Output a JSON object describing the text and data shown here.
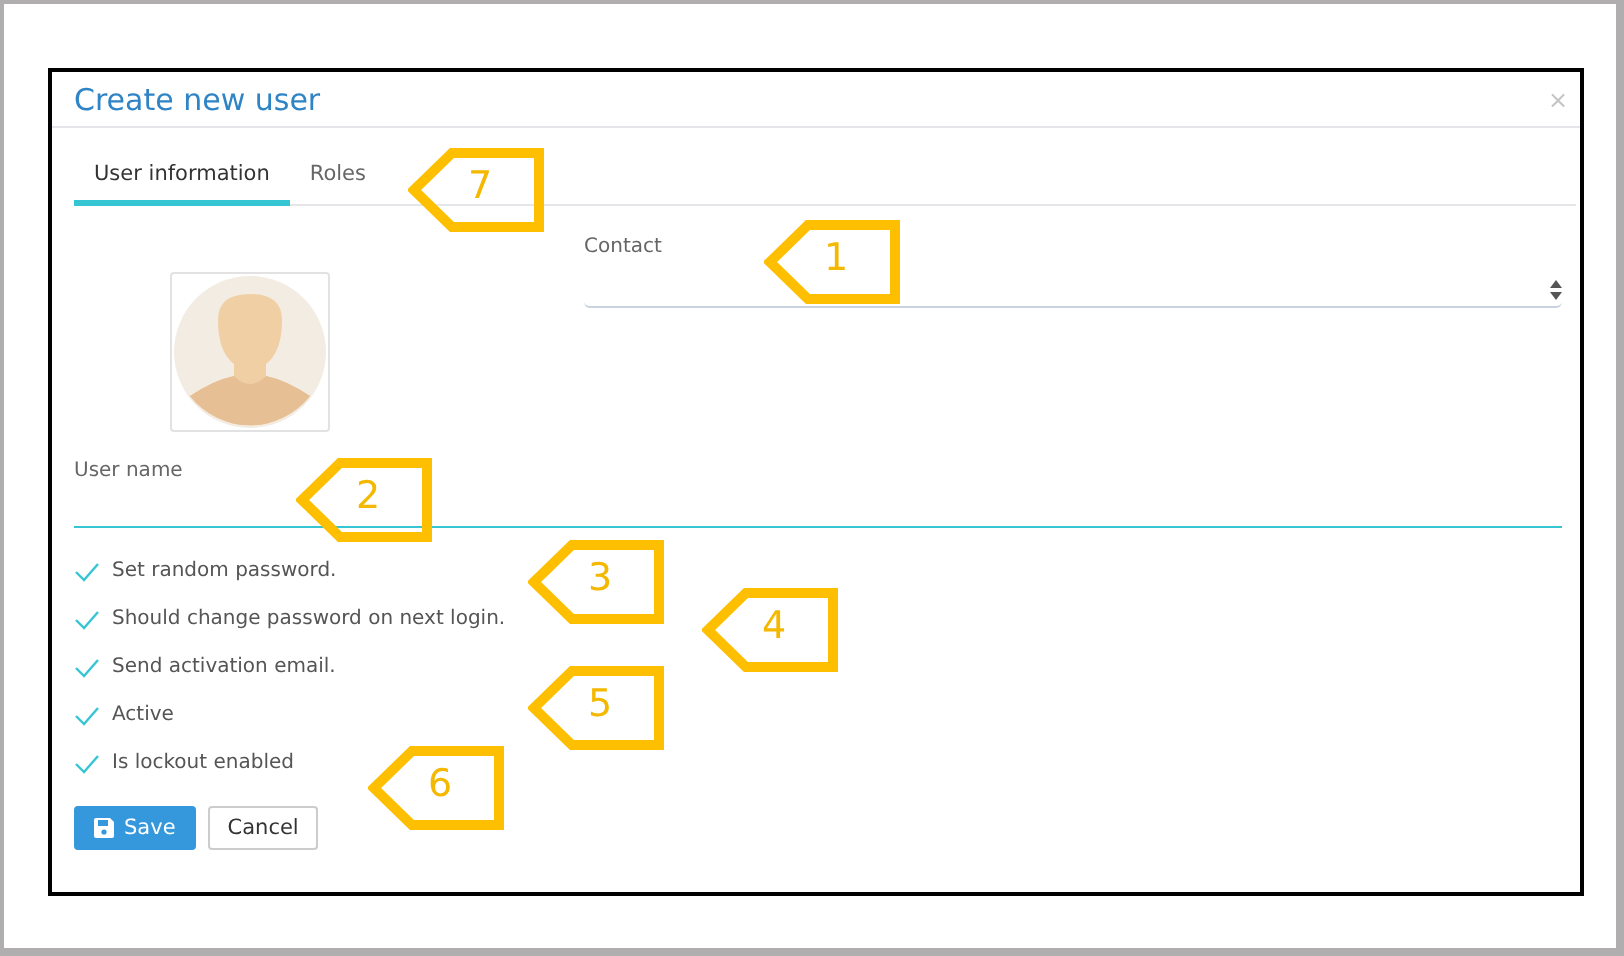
{
  "dialog": {
    "title": "Create new user",
    "close": "×"
  },
  "tabs": [
    {
      "label": "User information",
      "selected": true
    },
    {
      "label": "Roles",
      "selected": false
    }
  ],
  "contact": {
    "label": "Contact"
  },
  "user_name": {
    "label": "User name"
  },
  "options": [
    {
      "label": "Set random password.",
      "checked": true
    },
    {
      "label": "Should change password on next login.",
      "checked": true
    },
    {
      "label": "Send activation email.",
      "checked": true
    },
    {
      "label": "Active",
      "checked": true
    },
    {
      "label": "Is lockout enabled",
      "checked": true
    }
  ],
  "buttons": [
    {
      "label": "Save",
      "kind": "primary"
    },
    {
      "label": "Cancel",
      "kind": "default"
    }
  ],
  "callouts": [
    {
      "number": "7"
    },
    {
      "number": "1"
    },
    {
      "number": "2"
    },
    {
      "number": "3"
    },
    {
      "number": "4"
    },
    {
      "number": "5"
    },
    {
      "number": "6"
    }
  ]
}
